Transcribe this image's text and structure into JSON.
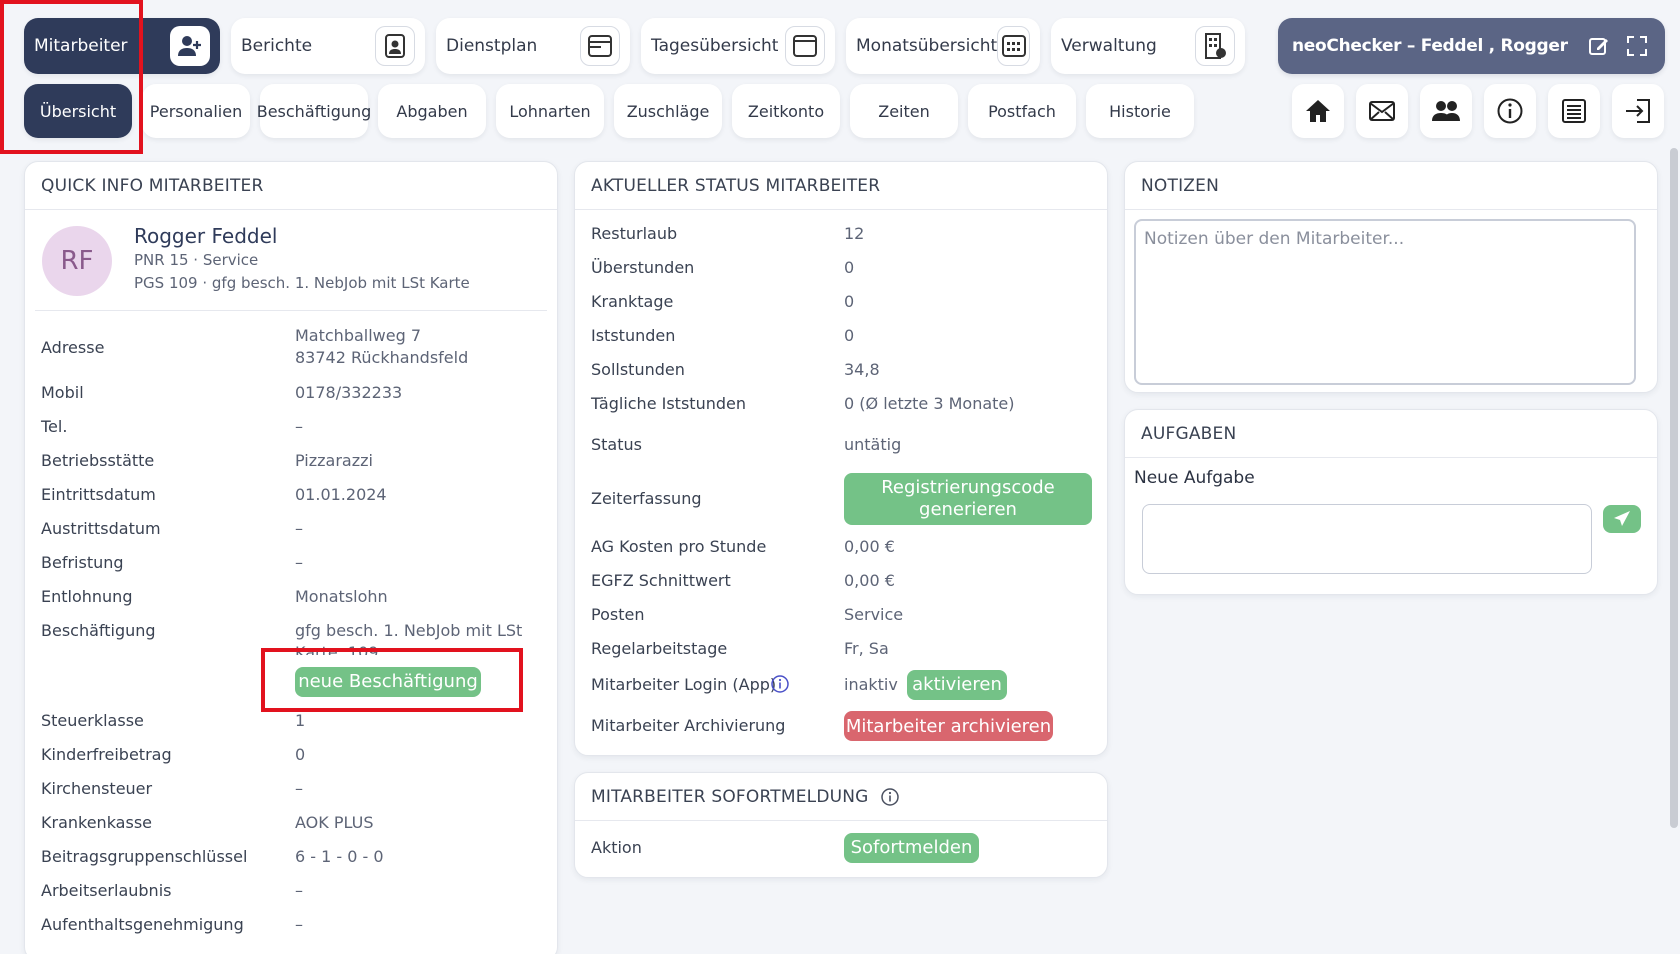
{
  "nav": {
    "tabs": [
      {
        "label": "Mitarbeiter",
        "icon": "add-user-icon",
        "active": true
      },
      {
        "label": "Berichte",
        "icon": "report-icon"
      },
      {
        "label": "Dienstplan",
        "icon": "schedule-icon"
      },
      {
        "label": "Tagesübersicht",
        "icon": "calendar-day-icon"
      },
      {
        "label": "Monatsübersicht",
        "icon": "calendar-month-icon"
      },
      {
        "label": "Verwaltung",
        "icon": "building-icon"
      }
    ],
    "app_title": "neoChecker – Feddel , Rogger",
    "sub_tabs": [
      "Übersicht",
      "Personalien",
      "Beschäftigung",
      "Abgaben",
      "Lohnarten",
      "Zuschläge",
      "Zeitkonto",
      "Zeiten",
      "Postfach",
      "Historie"
    ],
    "tools": [
      "home-icon",
      "mail-icon",
      "users-icon",
      "info-icon",
      "list-icon",
      "logout-icon"
    ]
  },
  "quick_info": {
    "header": "QUICK INFO MITARBEITER",
    "initials": "RF",
    "name": "Rogger Feddel",
    "line1": "PNR 15 · Service",
    "line2": "PGS 109 · gfg besch. 1. NebJob mit LSt Karte",
    "labels": {
      "adresse": "Adresse",
      "mobil": "Mobil",
      "tel": "Tel.",
      "betrieb": "Betriebsstätte",
      "eintritt": "Eintrittsdatum",
      "austritt": "Austrittsdatum",
      "befristung": "Befristung",
      "entlohnung": "Entlohnung",
      "beschaeftigung": "Beschäftigung",
      "steuerklasse": "Steuerklasse",
      "kinder": "Kinderfreibetrag",
      "kirche": "Kirchensteuer",
      "krankenkasse": "Krankenkasse",
      "beitrag": "Beitragsgruppenschlüssel",
      "arbeitserlaubnis": "Arbeitserlaubnis",
      "aufenthalt": "Aufenthaltsgenehmigung"
    },
    "values": {
      "adresse1": "Matchballweg 7",
      "adresse2": "83742 Rückhandsfeld",
      "mobil": "0178/332233",
      "tel": "–",
      "betrieb": "Pizzarazzi",
      "eintritt": "01.01.2024",
      "austritt": "–",
      "befristung": "–",
      "entlohnung": "Monatslohn",
      "beschaeftigung1": "gfg besch. 1. NebJob mit LSt",
      "beschaeftigung2": "Karte, 109",
      "steuerklasse": "1",
      "kinder": "0",
      "kirche": "–",
      "krankenkasse": "AOK PLUS",
      "beitrag": "6 - 1 - 0 - 0",
      "arbeitserlaubnis": "–",
      "aufenthalt": "–"
    },
    "neue_button": "neue Beschäftigung"
  },
  "status": {
    "header": "AKTUELLER STATUS MITARBEITER",
    "rows": {
      "resturlaub": [
        "Resturlaub",
        "12"
      ],
      "ueberstunden": [
        "Überstunden",
        "0"
      ],
      "kranktage": [
        "Kranktage",
        "0"
      ],
      "iststunden": [
        "Iststunden",
        "0"
      ],
      "sollstunden": [
        "Sollstunden",
        "34,8"
      ],
      "taeglich": [
        "Tägliche Iststunden",
        "0  (Ø letzte 3 Monate)"
      ],
      "status": [
        "Status",
        "untätig"
      ],
      "zeiterfassung": [
        "Zeiterfassung",
        ""
      ],
      "agkosten": [
        "AG Kosten pro Stunde",
        "0,00 €"
      ],
      "egfz": [
        "EGFZ Schnittwert",
        "0,00 €"
      ],
      "posten": [
        "Posten",
        "Service"
      ],
      "regel": [
        "Regelarbeitstage",
        "Fr, Sa"
      ],
      "login": [
        "Mitarbeiter Login (App)",
        "inaktiv"
      ],
      "archiv": [
        "Mitarbeiter Archivierung",
        ""
      ]
    },
    "reg_button_1": "Registrierungscode",
    "reg_button_2": "generieren",
    "aktivieren_button": "aktivieren",
    "archivieren_button": "Mitarbeiter archivieren"
  },
  "sofort": {
    "header": "MITARBEITER SOFORTMELDUNG",
    "label": "Aktion",
    "button": "Sofortmelden"
  },
  "notizen": {
    "header": "NOTIZEN",
    "placeholder": "Notizen über den Mitarbeiter..."
  },
  "aufgaben": {
    "header": "AUFGABEN",
    "label": "Neue Aufgabe"
  }
}
